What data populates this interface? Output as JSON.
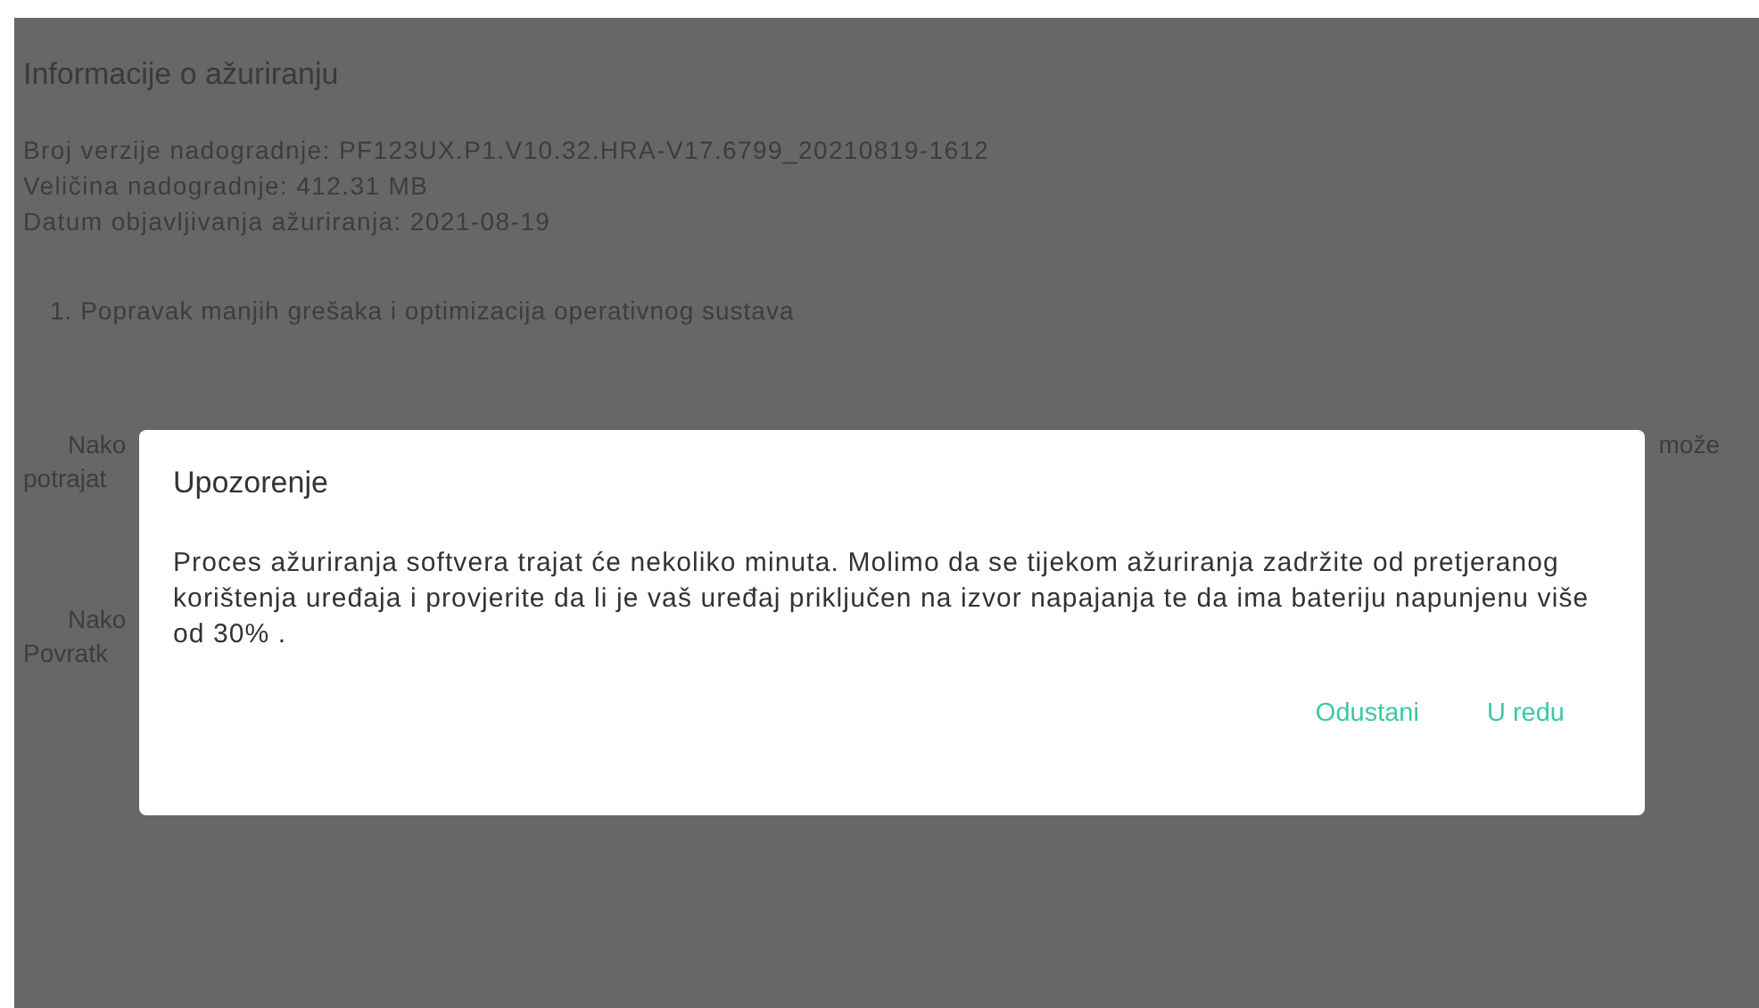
{
  "page": {
    "title": "Informacije o ažuriranju",
    "details": [
      "Broj verzije nadogradnje: PF123UX.P1.V10.32.HRA-V17.6799_20210819-1612",
      "Veličina nadogradnje: 412.31 MB",
      "Datum objavljivanja ažuriranja: 2021-08-19"
    ],
    "changes": [
      "1. Popravak manjih grešaka i optimizacija operativnog sustava"
    ],
    "covered_paragraphs": [
      {
        "first_line_start": "Nako",
        "first_line_end": "može",
        "second_line_start": "potrajat"
      },
      {
        "first_line_start": "Nako",
        "second_line_start": "Povratk"
      }
    ]
  },
  "dialog": {
    "title": "Upozorenje",
    "message": "Proces ažuriranja softvera trajat će nekoliko minuta. Molimo da se tijekom ažuriranja zadržite od pretjeranog korištenja uređaja i provjerite da li je vaš uređaj priključen na izvor napajanja te da ima bateriju napunjenu više od 30% .",
    "buttons": [
      "Odustani",
      "U redu"
    ]
  }
}
